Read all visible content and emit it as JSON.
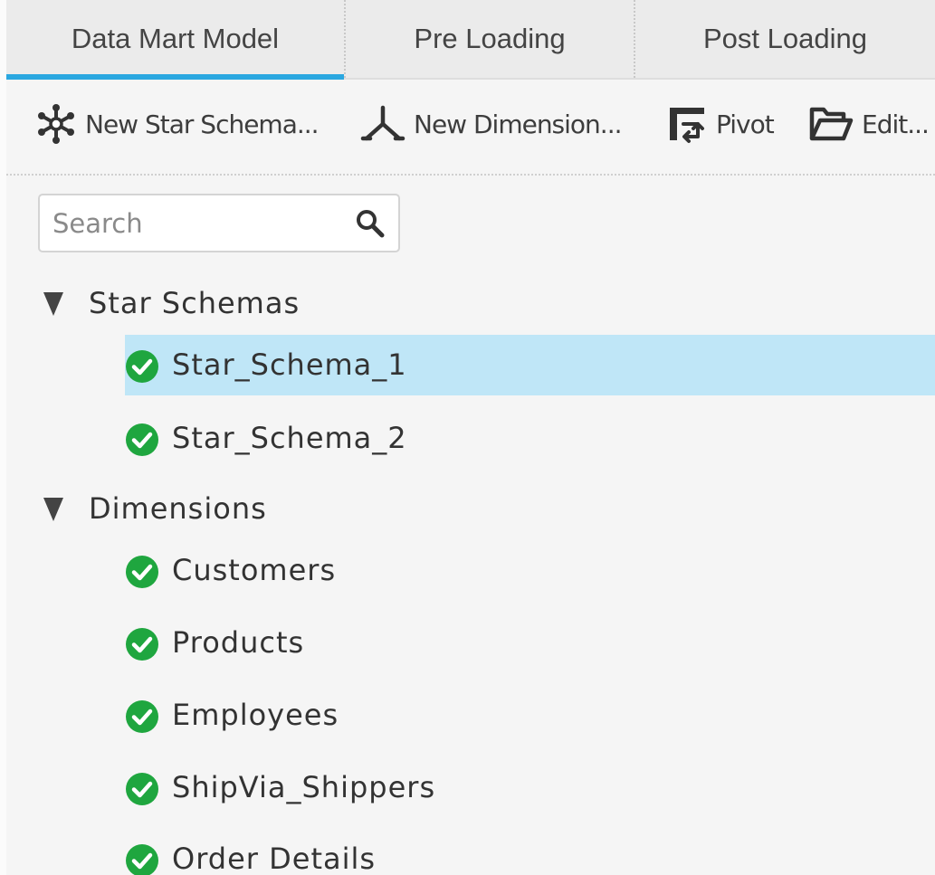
{
  "tabs": [
    {
      "label": "Data Mart Model",
      "active": true
    },
    {
      "label": "Pre Loading",
      "active": false
    },
    {
      "label": "Post Loading",
      "active": false
    }
  ],
  "toolbar": {
    "new_star_schema": {
      "label": "New Star Schema...",
      "icon": "star-schema-icon"
    },
    "new_dimension": {
      "label": "New Dimension...",
      "icon": "dimension-icon"
    },
    "pivot": {
      "label": "Pivot",
      "icon": "pivot-icon"
    },
    "edit": {
      "label": "Edit...",
      "icon": "folder-open-icon"
    }
  },
  "search": {
    "placeholder": "Search",
    "value": ""
  },
  "tree": {
    "groups": [
      {
        "label": "Star Schemas",
        "expanded": true,
        "items": [
          {
            "label": "Star_Schema_1",
            "status": "valid",
            "selected": true
          },
          {
            "label": "Star_Schema_2",
            "status": "valid",
            "selected": false
          }
        ]
      },
      {
        "label": "Dimensions",
        "expanded": true,
        "items": [
          {
            "label": "Customers",
            "status": "valid",
            "selected": false
          },
          {
            "label": "Products",
            "status": "valid",
            "selected": false
          },
          {
            "label": "Employees",
            "status": "valid",
            "selected": false
          },
          {
            "label": "ShipVia_Shippers",
            "status": "valid",
            "selected": false
          },
          {
            "label": "Order Details",
            "status": "valid",
            "selected": false
          }
        ]
      }
    ]
  },
  "colors": {
    "accent": "#2aa7e0",
    "selection": "#bfe6f7",
    "valid": "#1fa63f",
    "tab_bg": "#ebebeb",
    "panel_bg": "#f5f5f5"
  }
}
